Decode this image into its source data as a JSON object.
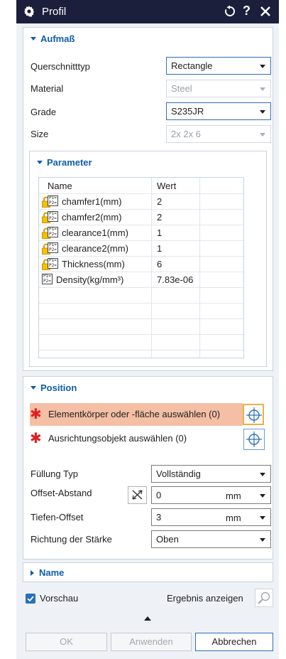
{
  "titlebar": {
    "title": "Profil",
    "icons": [
      "gear-icon",
      "reset-icon",
      "help-icon",
      "close-icon"
    ],
    "help_glyph": "?"
  },
  "aufmass": {
    "header": "Aufmaß",
    "querschnitt_label": "Querschnitttyp",
    "querschnitt_value": "Rectangle",
    "material_label": "Material",
    "material_value": "Steel",
    "grade_label": "Grade",
    "grade_value": "S235JR",
    "size_label": "Size",
    "size_value": "2x 2x 6"
  },
  "parameter": {
    "header": "Parameter",
    "col_name": "Name",
    "col_value": "Wert",
    "rows": [
      {
        "name": "chamfer1(mm)",
        "value": "2",
        "locked": true
      },
      {
        "name": "chamfer2(mm)",
        "value": "2",
        "locked": true
      },
      {
        "name": "clearance1(mm)",
        "value": "1",
        "locked": true
      },
      {
        "name": "clearance2(mm)",
        "value": "1",
        "locked": true
      },
      {
        "name": "Thickness(mm)",
        "value": "6",
        "locked": true
      },
      {
        "name": "Density(kg/mm³)",
        "value": "7.83e-06",
        "locked": false
      }
    ],
    "formula_icon_text": "P1= P2="
  },
  "position": {
    "header": "Position",
    "select_body": "Elementkörper oder -fläche auswählen (0)",
    "select_orient": "Ausrichtungsobjekt auswählen (0)",
    "star": "✱",
    "fill_label": "Füllung Typ",
    "fill_value": "Vollständig",
    "offset_label": "Offset-Abstand",
    "offset_value": "0",
    "offset_unit": "mm",
    "depth_label": "Tiefen-Offset",
    "depth_value": "3",
    "depth_unit": "mm",
    "direction_label": "Richtung der Stärke",
    "direction_value": "Oben"
  },
  "name_section": {
    "header": "Name"
  },
  "footer": {
    "preview_label": "Vorschau",
    "preview_checked": true,
    "result_label": "Ergebnis anzeigen",
    "ok": "OK",
    "apply": "Anwenden",
    "cancel": "Abbrechen"
  },
  "colors": {
    "titlebar": "#1c1f3b",
    "accent": "#0d5ea7",
    "highlight": "#f4bfa4",
    "required": "#e02020"
  }
}
